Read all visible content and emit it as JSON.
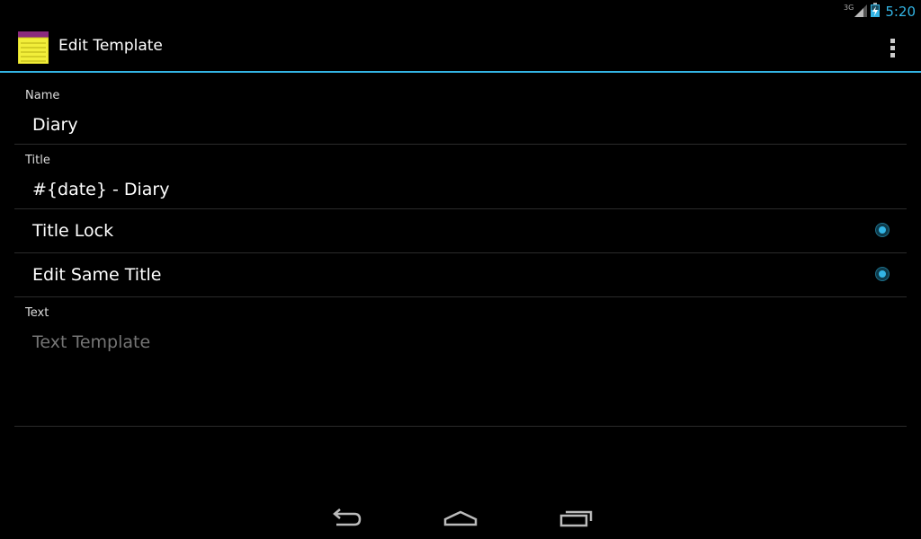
{
  "status_bar": {
    "network_type": "3G",
    "time": "5:20",
    "icons": [
      "signal-icon",
      "battery-charging-icon"
    ]
  },
  "action_bar": {
    "title": "Edit Template",
    "app_icon": "notepad-icon",
    "overflow_icon": "overflow-menu-icon"
  },
  "form": {
    "name": {
      "label": "Name",
      "value": "Diary"
    },
    "title": {
      "label": "Title",
      "value": "#{date} - Diary"
    },
    "title_lock": {
      "label": "Title Lock",
      "checked": true
    },
    "edit_same_title": {
      "label": "Edit Same Title",
      "checked": true
    },
    "text": {
      "label": "Text",
      "value": "",
      "placeholder": "Text Template"
    }
  },
  "nav_bar": {
    "buttons": [
      "back-icon",
      "home-icon",
      "recent-apps-icon"
    ]
  },
  "colors": {
    "accent": "#33b5e5",
    "background": "#000000",
    "divider": "#2b2b2b",
    "hint_text": "#8a8a8a"
  }
}
